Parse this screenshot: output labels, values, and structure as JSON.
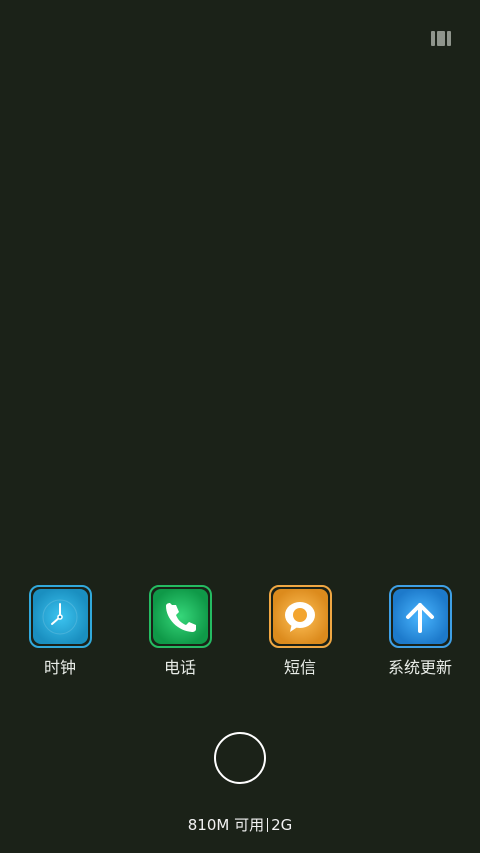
{
  "status": {
    "icon": "overview-grid-icon"
  },
  "dock": {
    "apps": [
      {
        "label": "时钟",
        "icon": "clock-icon",
        "accent": "#32a9dc"
      },
      {
        "label": "电话",
        "icon": "phone-icon",
        "accent": "#25bc62"
      },
      {
        "label": "短信",
        "icon": "message-icon",
        "accent": "#f0a743"
      },
      {
        "label": "系统更新",
        "icon": "arrow-up-icon",
        "accent": "#3fa0e6"
      }
    ]
  },
  "footer": {
    "memory": "810M 可用",
    "network": "2G"
  }
}
